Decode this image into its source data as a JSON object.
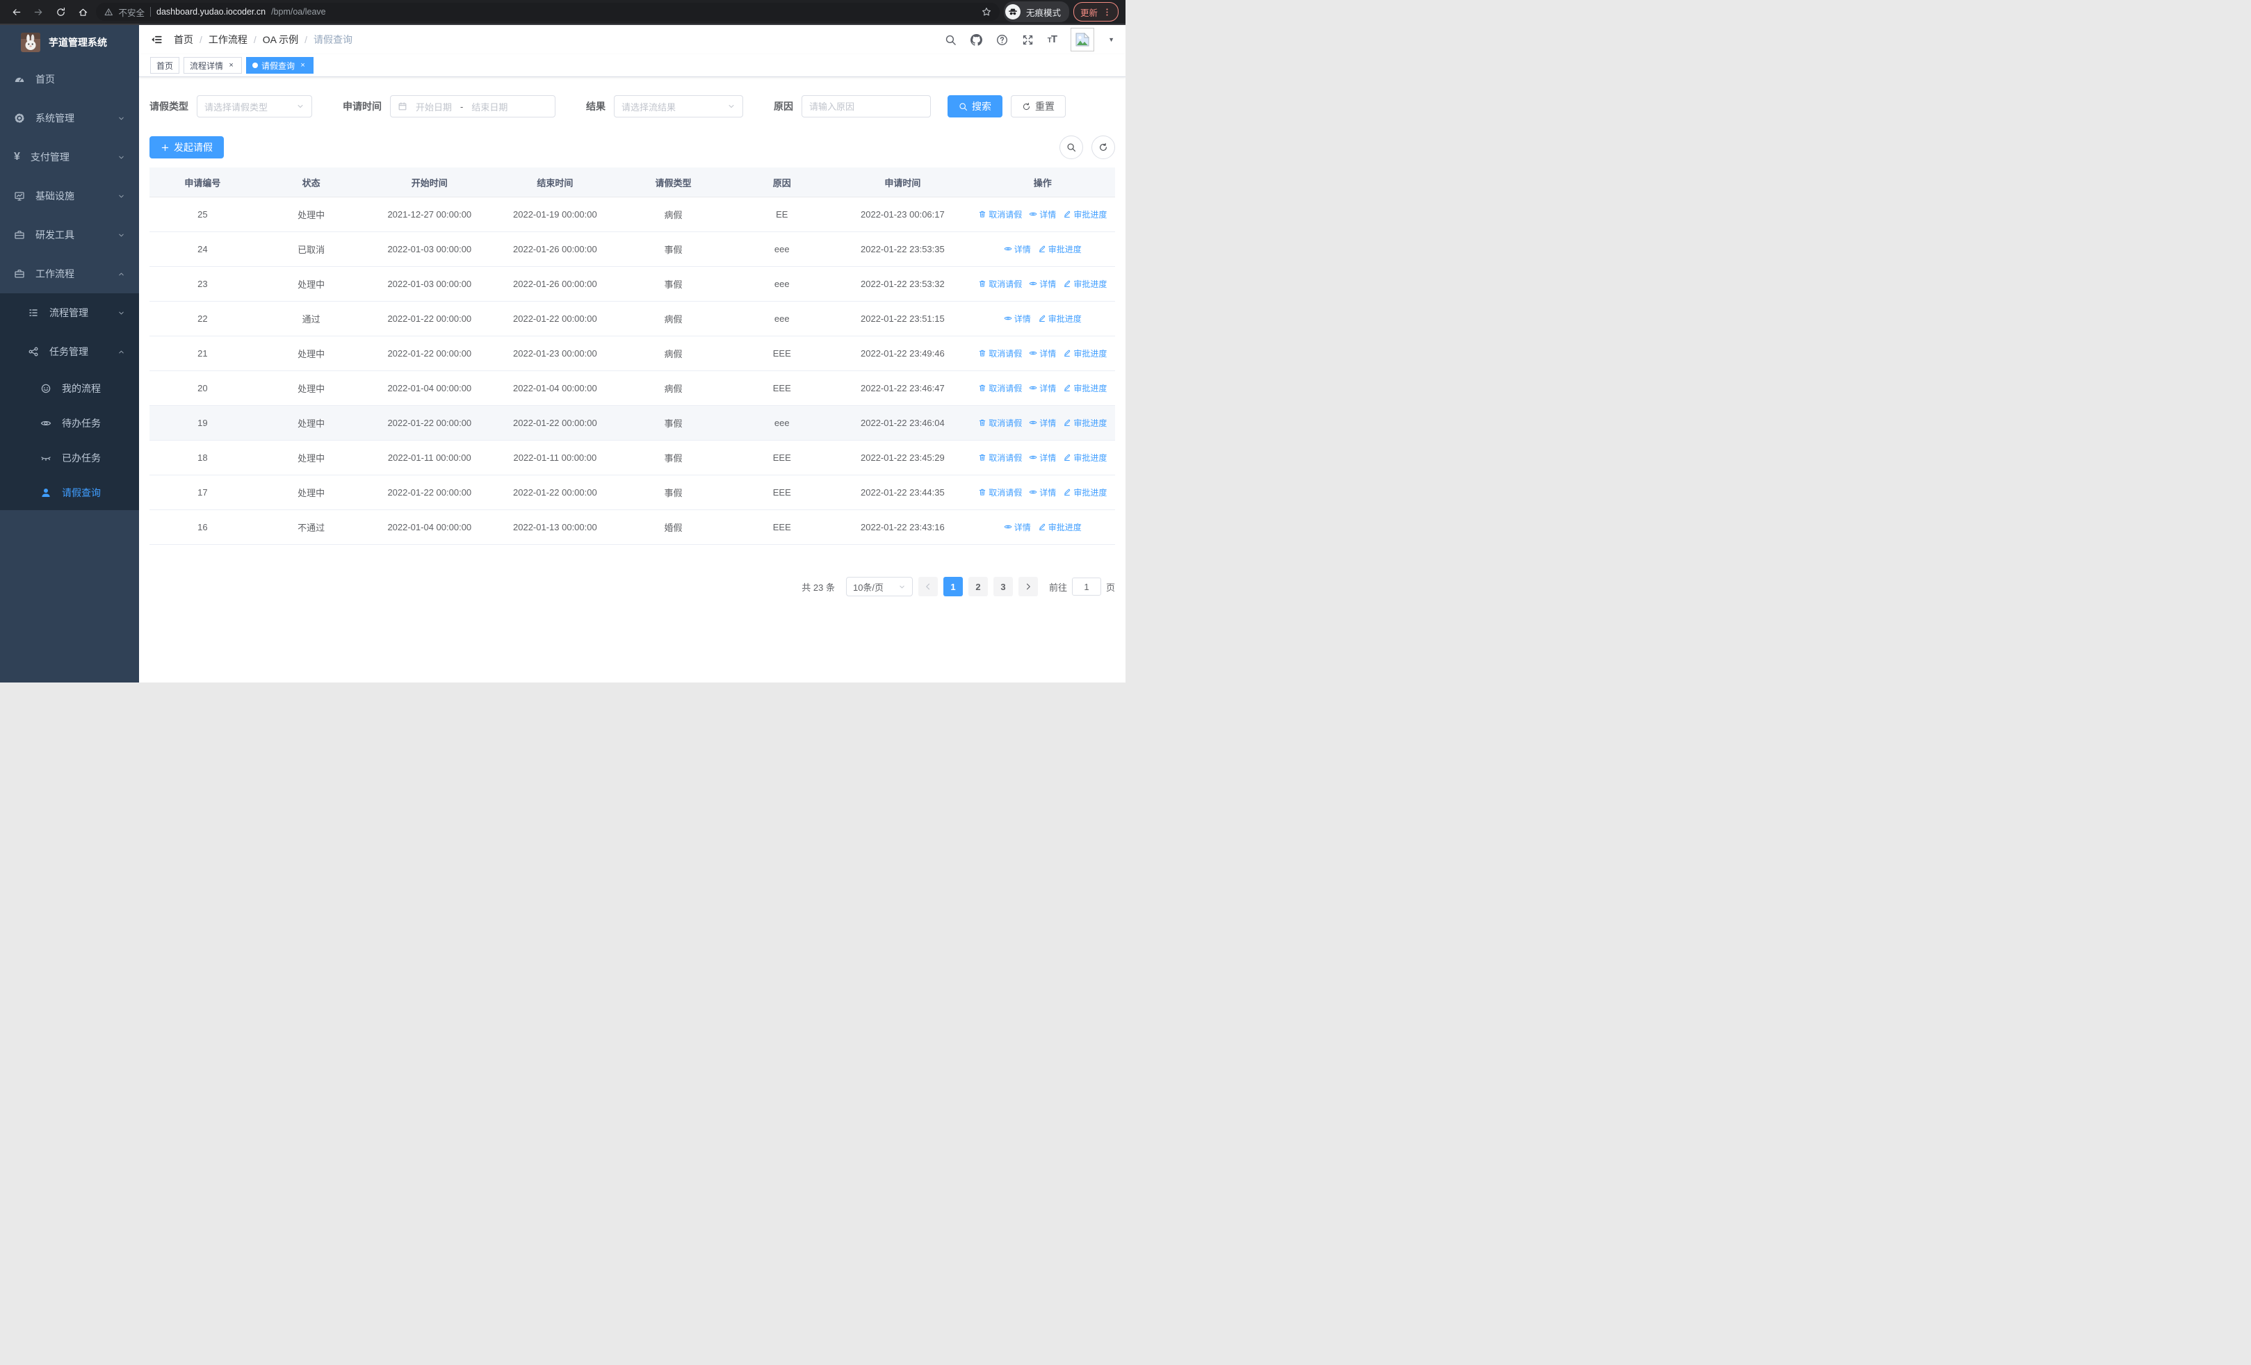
{
  "colors": {
    "accent": "#409eff",
    "sidebar_bg": "#304156",
    "submenu_bg": "#1f2d3d",
    "chrome_bg": "#202124",
    "link_blue": "#409eff",
    "update_red": "#f28b82",
    "row_hover": "#f5f7fa",
    "table_header_bg": "#f5f7fa"
  },
  "browser": {
    "security": "不安全",
    "host": "dashboard.yudao.iocoder.cn",
    "path": "/bpm/oa/leave",
    "incognito": "无痕模式",
    "update": "更新"
  },
  "app": {
    "title": "芋道管理系统"
  },
  "sidebar": {
    "items": [
      {
        "key": "home",
        "label": "首页",
        "icon": "dashboard",
        "level": 1,
        "sub": false
      },
      {
        "key": "system",
        "label": "系统管理",
        "icon": "gear",
        "level": 1,
        "arrow": "down",
        "sub": false
      },
      {
        "key": "payment",
        "label": "支付管理",
        "icon": "money",
        "level": 1,
        "arrow": "down",
        "sub": false
      },
      {
        "key": "infra",
        "label": "基础设施",
        "icon": "monitor",
        "level": 1,
        "arrow": "down",
        "sub": false
      },
      {
        "key": "devtools",
        "label": "研发工具",
        "icon": "briefcase",
        "level": 1,
        "arrow": "down",
        "sub": false
      },
      {
        "key": "workflow",
        "label": "工作流程",
        "icon": "briefcase",
        "level": 1,
        "arrow": "up",
        "sub": false
      },
      {
        "key": "process-mgmt",
        "label": "流程管理",
        "icon": "treeTable",
        "level": 2,
        "arrow": "down",
        "sub": true
      },
      {
        "key": "task-mgmt",
        "label": "任务管理",
        "icon": "tree",
        "level": 2,
        "arrow": "up",
        "sub": true
      },
      {
        "key": "my-process",
        "label": "我的流程",
        "icon": "face",
        "level": 3,
        "sub": true
      },
      {
        "key": "todo-task",
        "label": "待办任务",
        "icon": "eyeOpen",
        "level": 3,
        "sub": true
      },
      {
        "key": "done-task",
        "label": "已办任务",
        "icon": "eyeClosed",
        "level": 3,
        "sub": true
      },
      {
        "key": "leave-query",
        "label": "请假查询",
        "icon": "user",
        "level": 3,
        "sub": true,
        "active": true
      }
    ]
  },
  "header": {
    "breadcrumb": [
      "首页",
      "工作流程",
      "OA 示例",
      "请假查询"
    ]
  },
  "tags": [
    {
      "label": "首页",
      "closable": false,
      "active": false
    },
    {
      "label": "流程详情",
      "closable": true,
      "active": false
    },
    {
      "label": "请假查询",
      "closable": true,
      "active": true
    }
  ],
  "filters": {
    "leave_type": {
      "label": "请假类型",
      "placeholder": "请选择请假类型"
    },
    "apply_time": {
      "label": "申请时间",
      "start_placeholder": "开始日期",
      "separator": "-",
      "end_placeholder": "结束日期"
    },
    "result": {
      "label": "结果",
      "placeholder": "请选择流结果"
    },
    "reason": {
      "label": "原因",
      "placeholder": "请输入原因"
    },
    "search_label": "搜索",
    "reset_label": "重置"
  },
  "toolbar": {
    "create_label": "发起请假"
  },
  "table": {
    "columns": [
      "申请编号",
      "状态",
      "开始时间",
      "结束时间",
      "请假类型",
      "原因",
      "申请时间",
      "操作"
    ],
    "action_labels": {
      "cancel": "取消请假",
      "detail": "详情",
      "progress": "审批进度"
    },
    "rows": [
      {
        "id": "25",
        "status": "处理中",
        "start": "2021-12-27 00:00:00",
        "end": "2022-01-19 00:00:00",
        "type": "病假",
        "reason": "EE",
        "applied": "2022-01-23 00:06:17",
        "actions": [
          "cancel",
          "detail",
          "progress"
        ],
        "hover": false
      },
      {
        "id": "24",
        "status": "已取消",
        "start": "2022-01-03 00:00:00",
        "end": "2022-01-26 00:00:00",
        "type": "事假",
        "reason": "eee",
        "applied": "2022-01-22 23:53:35",
        "actions": [
          "detail",
          "progress"
        ],
        "hover": false
      },
      {
        "id": "23",
        "status": "处理中",
        "start": "2022-01-03 00:00:00",
        "end": "2022-01-26 00:00:00",
        "type": "事假",
        "reason": "eee",
        "applied": "2022-01-22 23:53:32",
        "actions": [
          "cancel",
          "detail",
          "progress"
        ],
        "hover": false
      },
      {
        "id": "22",
        "status": "通过",
        "start": "2022-01-22 00:00:00",
        "end": "2022-01-22 00:00:00",
        "type": "病假",
        "reason": "eee",
        "applied": "2022-01-22 23:51:15",
        "actions": [
          "detail",
          "progress"
        ],
        "hover": false
      },
      {
        "id": "21",
        "status": "处理中",
        "start": "2022-01-22 00:00:00",
        "end": "2022-01-23 00:00:00",
        "type": "病假",
        "reason": "EEE",
        "applied": "2022-01-22 23:49:46",
        "actions": [
          "cancel",
          "detail",
          "progress"
        ],
        "hover": false
      },
      {
        "id": "20",
        "status": "处理中",
        "start": "2022-01-04 00:00:00",
        "end": "2022-01-04 00:00:00",
        "type": "病假",
        "reason": "EEE",
        "applied": "2022-01-22 23:46:47",
        "actions": [
          "cancel",
          "detail",
          "progress"
        ],
        "hover": false
      },
      {
        "id": "19",
        "status": "处理中",
        "start": "2022-01-22 00:00:00",
        "end": "2022-01-22 00:00:00",
        "type": "事假",
        "reason": "eee",
        "applied": "2022-01-22 23:46:04",
        "actions": [
          "cancel",
          "detail",
          "progress"
        ],
        "hover": true
      },
      {
        "id": "18",
        "status": "处理中",
        "start": "2022-01-11 00:00:00",
        "end": "2022-01-11 00:00:00",
        "type": "事假",
        "reason": "EEE",
        "applied": "2022-01-22 23:45:29",
        "actions": [
          "cancel",
          "detail",
          "progress"
        ],
        "hover": false
      },
      {
        "id": "17",
        "status": "处理中",
        "start": "2022-01-22 00:00:00",
        "end": "2022-01-22 00:00:00",
        "type": "事假",
        "reason": "EEE",
        "applied": "2022-01-22 23:44:35",
        "actions": [
          "cancel",
          "detail",
          "progress"
        ],
        "hover": false
      },
      {
        "id": "16",
        "status": "不通过",
        "start": "2022-01-04 00:00:00",
        "end": "2022-01-13 00:00:00",
        "type": "婚假",
        "reason": "EEE",
        "applied": "2022-01-22 23:43:16",
        "actions": [
          "detail",
          "progress"
        ],
        "hover": false
      }
    ]
  },
  "pagination": {
    "total": "共 23 条",
    "page_size": "10条/页",
    "pages": [
      "1",
      "2",
      "3"
    ],
    "active_page": "1",
    "goto_label": "前往",
    "goto_value": "1",
    "goto_suffix": "页"
  }
}
